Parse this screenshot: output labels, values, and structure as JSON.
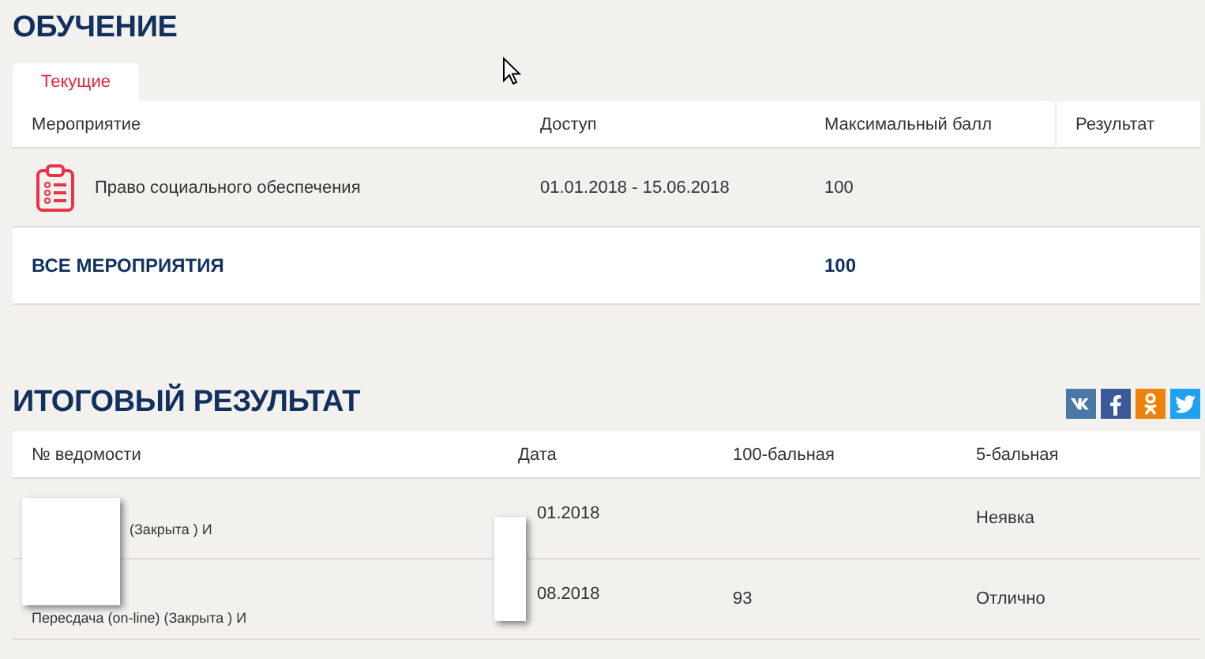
{
  "training": {
    "title": "ОБУЧЕНИЕ",
    "tabs": [
      {
        "label": "Текущие",
        "selected": true
      }
    ],
    "columns": [
      "Мероприятие",
      "Доступ",
      "Максимальный балл",
      "Результат"
    ],
    "rows": [
      {
        "name": "Право социального обеспечения",
        "access": "01.01.2018 - 15.06.2018",
        "max_score": "100"
      }
    ],
    "total": {
      "label": "ВСЕ МЕРОПРИЯТИЯ",
      "max_score": "100"
    }
  },
  "final": {
    "title": "ИТОГОВЫЙ РЕЗУЛЬТАТ",
    "share": [
      {
        "kind": "vk",
        "color": "#4a76a8"
      },
      {
        "kind": "facebook",
        "color": "#3b5998"
      },
      {
        "kind": "odnoklassniki",
        "color": "#ee8208"
      },
      {
        "kind": "twitter",
        "color": "#1da1f2"
      }
    ],
    "columns": [
      "№ ведомости",
      "Дата",
      "100-бальная",
      "5-бальная"
    ],
    "rows": [
      {
        "statement": "(Закрыта ) И",
        "date": "01.2018",
        "score100": "",
        "score5": "Неявка"
      },
      {
        "statement": "Пересдача (on-line) (Закрыта ) И",
        "date": "08.2018",
        "score100": "93",
        "score5": "Отлично"
      }
    ]
  }
}
